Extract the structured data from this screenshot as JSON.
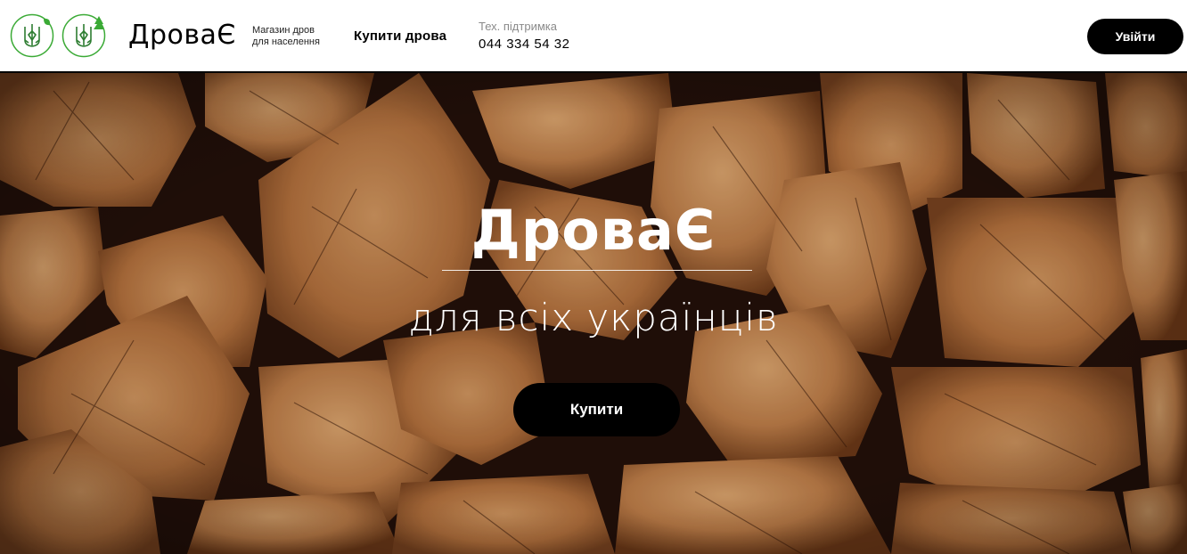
{
  "header": {
    "brand": "ДроваЄ",
    "tagline_line1": "Магазин дров",
    "tagline_line2": "для населення",
    "nav_buy": "Купити дрова",
    "support_label": "Тех. підтримка",
    "support_phone": "044 334 54 32",
    "login_label": "Увійти"
  },
  "hero": {
    "title": "ДроваЄ",
    "subtitle": "для всіх українців",
    "buy_label": "Купити"
  },
  "colors": {
    "accent_green": "#3aaa35",
    "button_black": "#000000",
    "wood_light": "#c98a52",
    "wood_dark": "#6b3a1c"
  },
  "icons": {
    "emblem_left": "trident-leaf-icon",
    "emblem_right": "trident-tree-icon"
  }
}
